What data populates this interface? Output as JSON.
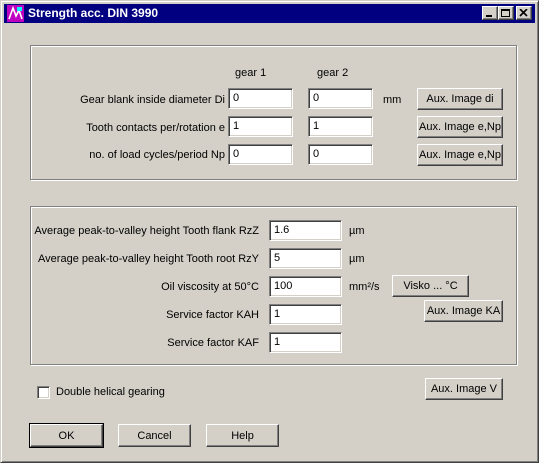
{
  "window": {
    "title": "Strength acc. DIN 3990"
  },
  "gear_group": {
    "col_gear1": "gear 1",
    "col_gear2": "gear 2",
    "rows": [
      {
        "label": "Gear blank inside diameter Di",
        "gear1": "0",
        "gear2": "0",
        "unit": "mm",
        "button": "Aux. Image di"
      },
      {
        "label": "Tooth contacts per/rotation e",
        "gear1": "1",
        "gear2": "1",
        "unit": "",
        "button": "Aux. Image e,Np"
      },
      {
        "label": "no. of load cycles/period Np",
        "gear1": "0",
        "gear2": "0",
        "unit": "",
        "button": "Aux. Image e,Np"
      }
    ]
  },
  "material_group": {
    "rows": [
      {
        "label": "Average peak-to-valley height Tooth flank RzZ",
        "value": "1.6",
        "unit": "µm"
      },
      {
        "label": "Average peak-to-valley height Tooth root RzY",
        "value": "5",
        "unit": "µm"
      },
      {
        "label": "Oil viscosity at 50°C",
        "value": "100",
        "unit": "mm²/s"
      },
      {
        "label": "Service factor KAH",
        "value": "1",
        "unit": ""
      },
      {
        "label": "Service factor KAF",
        "value": "1",
        "unit": ""
      }
    ],
    "visko_button": "Visko ... °C",
    "aux_ka_button": "Aux. Image KA"
  },
  "double_helical": {
    "label": "Double helical gearing",
    "checked": false
  },
  "aux_v_button": "Aux. Image V",
  "footer": {
    "ok": "OK",
    "cancel": "Cancel",
    "help": "Help"
  },
  "colors": {
    "titlebar": "#000080",
    "face": "#d4d0c8"
  }
}
